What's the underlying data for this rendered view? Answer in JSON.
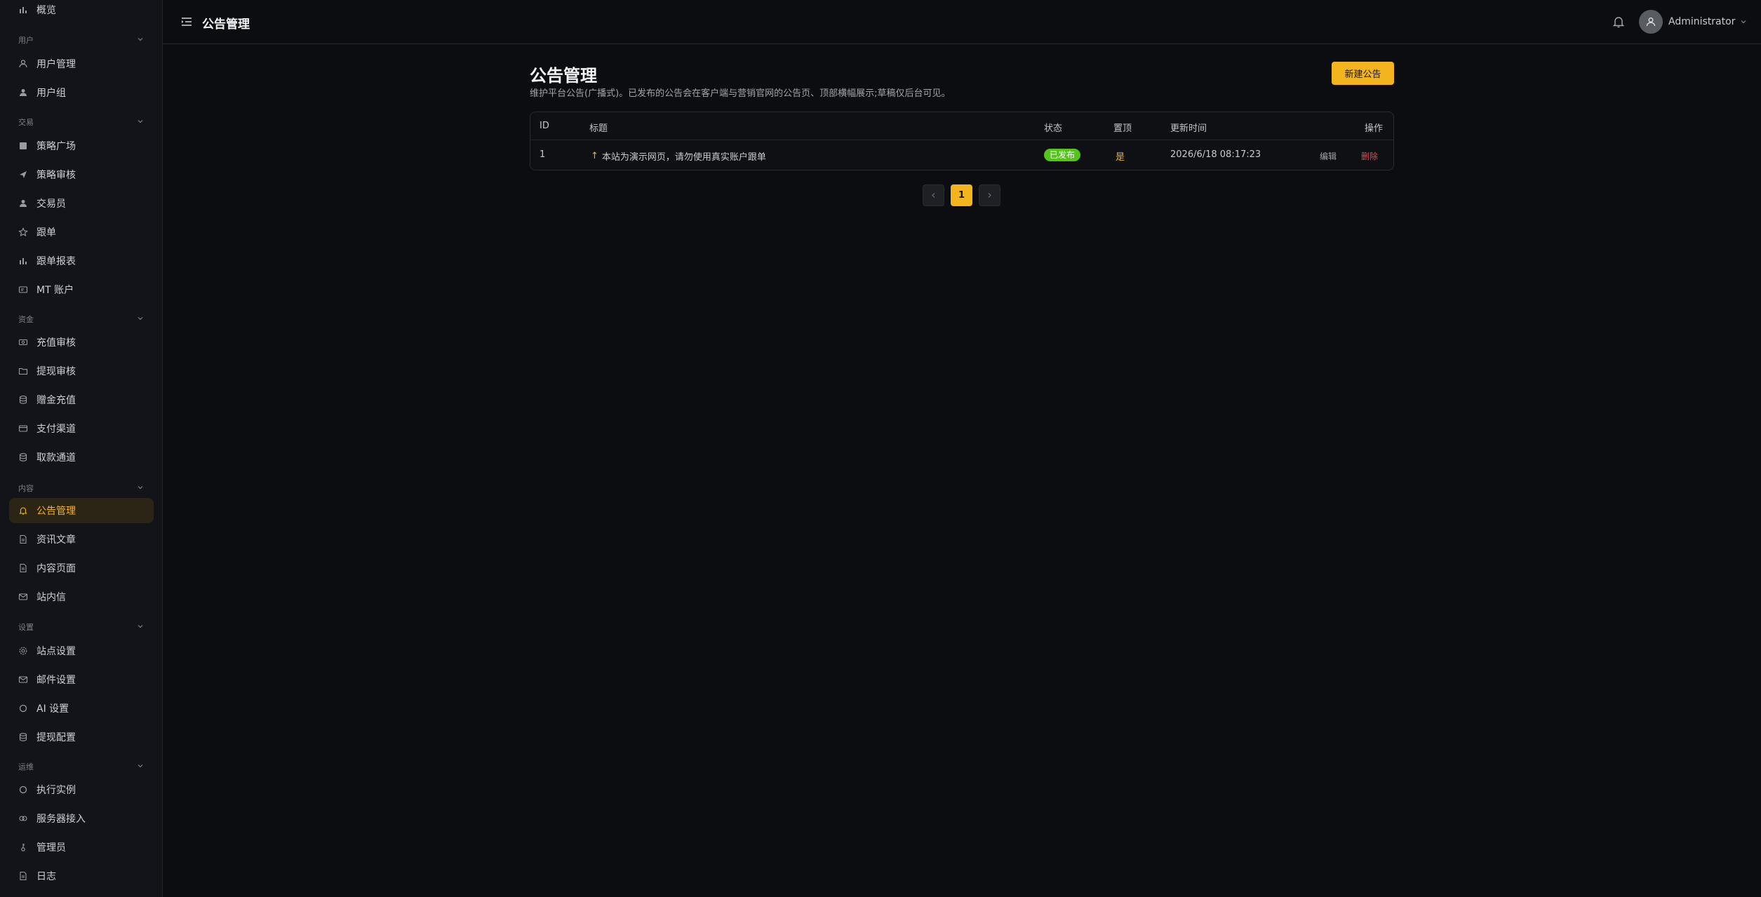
{
  "header": {
    "title": "公告管理",
    "username": "Administrator"
  },
  "sidebar": {
    "overview": "概览",
    "sections": [
      {
        "label": "用户",
        "items": [
          "用户管理",
          "用户组"
        ]
      },
      {
        "label": "交易",
        "items": [
          "策略广场",
          "策略审核",
          "交易员",
          "跟单",
          "跟单报表",
          "MT 账户"
        ]
      },
      {
        "label": "资金",
        "items": [
          "充值审核",
          "提现审核",
          "赠金充值",
          "支付渠道",
          "取款通道"
        ]
      },
      {
        "label": "内容",
        "items": [
          "公告管理",
          "资讯文章",
          "内容页面",
          "站内信"
        ]
      },
      {
        "label": "设置",
        "items": [
          "站点设置",
          "邮件设置",
          "AI 设置",
          "提现配置"
        ]
      },
      {
        "label": "运维",
        "items": [
          "执行实例",
          "服务器接入",
          "管理员",
          "日志"
        ]
      }
    ]
  },
  "page": {
    "title": "公告管理",
    "description": "维护平台公告(广播式)。已发布的公告会在客户端与营销官网的公告页、顶部横幅展示;草稿仅后台可见。",
    "new_button": "新建公告"
  },
  "table": {
    "columns": {
      "id": "ID",
      "title": "标题",
      "status": "状态",
      "pinned": "置顶",
      "updated": "更新时间",
      "actions": "操作"
    },
    "rows": [
      {
        "id": "1",
        "pin_icon": "↑",
        "title": "本站为演示网页，请勿使用真实账户跟单",
        "status": "已发布",
        "pinned": "是",
        "updated": "2026/6/18 08:17:23",
        "edit": "编辑",
        "delete": "删除"
      }
    ]
  },
  "pagination": {
    "current": "1"
  },
  "colors": {
    "accent": "#f2b51e",
    "published": "#52c41a",
    "danger": "#e5484d",
    "background": "#0c0d10"
  }
}
